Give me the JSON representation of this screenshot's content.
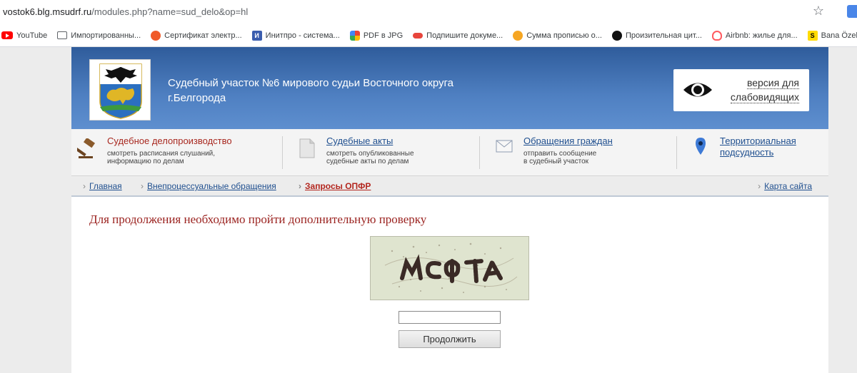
{
  "browser": {
    "url_host": "vostok6.blg.msudrf.ru",
    "url_path": "/modules.php?name=sud_delo&op=hl",
    "bookmarks": [
      {
        "label": "YouTube",
        "icon": "youtube-icon"
      },
      {
        "label": "Импортированны...",
        "icon": "folder-icon"
      },
      {
        "label": "Сертификат электр...",
        "icon": "certificate-icon"
      },
      {
        "label": "Инитпро - система...",
        "icon": "initpro-icon",
        "glyph": "И"
      },
      {
        "label": "PDF в JPG",
        "icon": "pdf-icon"
      },
      {
        "label": "Подпишите докуме...",
        "icon": "sign-icon"
      },
      {
        "label": "Сумма прописью о...",
        "icon": "sum-icon"
      },
      {
        "label": "Произительная цит...",
        "icon": "quote-icon"
      },
      {
        "label": "Airbnb: жилье для...",
        "icon": "airbnb-icon"
      },
      {
        "label": "Bana Özel Özet",
        "icon": "s-icon",
        "glyph": "S"
      }
    ]
  },
  "header": {
    "court_name": "Судебный участок №6 мирового судьи Восточного округа г.Белгорода",
    "vision_label": "версия для слабовидящих"
  },
  "menu": [
    {
      "title": "Судебное делопроизводство",
      "sub1": "смотреть расписания слушаний,",
      "sub2": "информацию по делам"
    },
    {
      "title": "Судебные акты",
      "sub1": "смотреть опубликованные",
      "sub2": "судебные акты по делам"
    },
    {
      "title": "Обращения граждан",
      "sub1": "отправить сообщение",
      "sub2": "в судебный участок"
    },
    {
      "title1": "Территориальная",
      "title2": "подсудность"
    }
  ],
  "breadcrumbs": {
    "items": [
      "Главная",
      "Внепроцессуальные обращения",
      "Запросы ОПФР"
    ],
    "sitemap": "Карта сайта"
  },
  "content": {
    "notice": "Для продолжения необходимо пройти дополнительную проверку",
    "captcha_input_value": "",
    "continue_label": "Продолжить"
  },
  "colors": {
    "header_blue": "#4f80c2",
    "notice_red": "#9b2320",
    "link_blue": "#1f4f8f"
  }
}
